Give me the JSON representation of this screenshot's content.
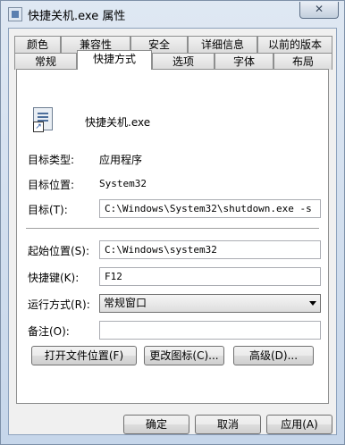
{
  "window": {
    "title": "快捷关机.exe 属性",
    "close_label": "✕"
  },
  "tabs_row1": [
    "颜色",
    "兼容性",
    "安全",
    "详细信息",
    "以前的版本"
  ],
  "tabs_row2": [
    "常规",
    "快捷方式",
    "选项",
    "字体",
    "布局"
  ],
  "active_tab": "快捷方式",
  "shortcut": {
    "name": "快捷关机.exe",
    "target_type_label": "目标类型:",
    "target_type_value": "应用程序",
    "target_location_label": "目标位置:",
    "target_location_value": "System32",
    "target_label": "目标(T):",
    "target_value": "C:\\Windows\\System32\\shutdown.exe -s",
    "start_in_label": "起始位置(S):",
    "start_in_value": "C:\\Windows\\system32",
    "hotkey_label": "快捷键(K):",
    "hotkey_value": "F12",
    "run_label": "运行方式(R):",
    "run_value": "常规窗口",
    "comment_label": "备注(O):",
    "comment_value": "",
    "open_location_button": "打开文件位置(F)",
    "change_icon_button": "更改图标(C)...",
    "advanced_button": "高级(D)..."
  },
  "footer": {
    "ok": "确定",
    "cancel": "取消",
    "apply": "应用(A)"
  },
  "colors": {
    "title_bg": "#cfdbe9",
    "panel_bg": "#ffffff",
    "dialog_bg": "#f0f0f0"
  },
  "icons": {
    "app_icon": "shortcut-exe-icon",
    "window_icon": "window-icon",
    "close": "close-icon",
    "dropdown": "chevron-down-icon"
  }
}
